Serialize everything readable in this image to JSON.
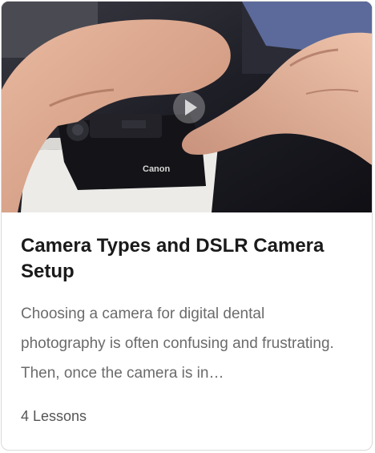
{
  "course_card": {
    "thumbnail": {
      "camera_brand": "Canon",
      "play_icon": "play-icon"
    },
    "title": "Camera Types and DSLR Camera Setup",
    "description": "Choosing a camera for digital dental photography is often confusing and frustrating. Then, once the camera is in…",
    "lessons_count": "4 Lessons"
  }
}
